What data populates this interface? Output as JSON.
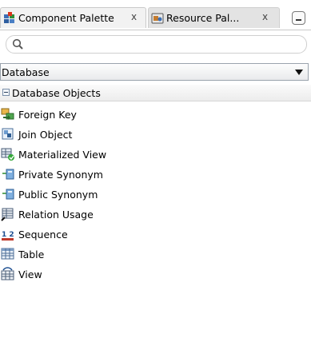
{
  "tabs": [
    {
      "label": "Component Palette",
      "icon": "component-palette-icon",
      "close": "x",
      "active": true
    },
    {
      "label": "Resource Pal...",
      "icon": "resource-palette-icon",
      "close": "x",
      "active": false
    }
  ],
  "search": {
    "value": "",
    "placeholder": ""
  },
  "category_select": {
    "value": "Database"
  },
  "section": {
    "title": "Database Objects",
    "expanded": true
  },
  "items": [
    {
      "label": "Foreign Key",
      "icon": "foreign-key-icon"
    },
    {
      "label": "Join Object",
      "icon": "join-object-icon"
    },
    {
      "label": "Materialized View",
      "icon": "materialized-view-icon"
    },
    {
      "label": "Private Synonym",
      "icon": "private-synonym-icon"
    },
    {
      "label": "Public Synonym",
      "icon": "public-synonym-icon"
    },
    {
      "label": "Relation Usage",
      "icon": "relation-usage-icon"
    },
    {
      "label": "Sequence",
      "icon": "sequence-icon"
    },
    {
      "label": "Table",
      "icon": "table-icon"
    },
    {
      "label": "View",
      "icon": "view-icon"
    }
  ],
  "seq_icon_text": "1 2",
  "colors": {
    "accent": "#3a6ea5",
    "tab_active_bg": "#f2f2f2",
    "border": "#c9c9c9"
  }
}
